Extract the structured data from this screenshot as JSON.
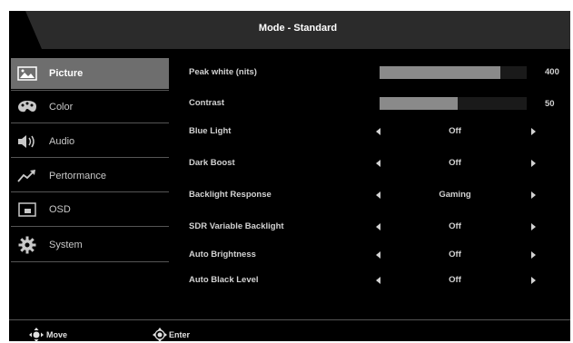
{
  "header": {
    "title": "Mode - Standard"
  },
  "menu": [
    {
      "label": "Picture",
      "icon": "picture-icon",
      "active": true
    },
    {
      "label": "Color",
      "icon": "palette-icon",
      "active": false
    },
    {
      "label": "Audio",
      "icon": "speaker-icon",
      "active": false
    },
    {
      "label": "Pertormance",
      "icon": "performance-icon",
      "active": false
    },
    {
      "label": "OSD",
      "icon": "osd-icon",
      "active": false
    },
    {
      "label": "System",
      "icon": "gear-icon",
      "active": false
    }
  ],
  "settings": {
    "peak_white": {
      "label": "Peak white (nits)",
      "value": "400",
      "level": 0.82
    },
    "contrast": {
      "label": "Contrast",
      "value": "50",
      "level": 0.53
    },
    "blue_light": {
      "label": "Blue Light",
      "value": "Off"
    },
    "dark_boost": {
      "label": "Dark Boost",
      "value": "Off"
    },
    "backlight_response": {
      "label": "Backlight Response",
      "value": "Gaming"
    },
    "sdr_variable_backlight": {
      "label": "SDR Variable Backlight",
      "value": "Off"
    },
    "auto_brightness": {
      "label": "Auto Brightness",
      "value": "Off"
    },
    "auto_black_level": {
      "label": "Auto Black Level",
      "value": "Off"
    }
  },
  "footer": {
    "move_label": "Move",
    "enter_label": "Enter"
  },
  "colors": {
    "panel": "#000000",
    "active": "#6e6e6e",
    "bar_fill": "#8a8a8a",
    "text": "#d2d2d2"
  }
}
